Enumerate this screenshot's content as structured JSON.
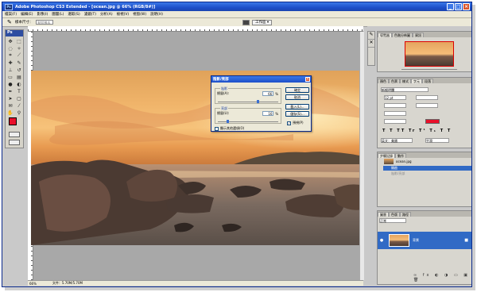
{
  "window": {
    "title": "Adobe Photoshop CS3 Extended - [ocean.jpg @ 66% (RGB/8#)]",
    "app_badge": "Ps"
  },
  "menu": [
    "檔案(F)",
    "編輯(E)",
    "影像(I)",
    "圖層(L)",
    "選取(S)",
    "濾鏡(T)",
    "分析(A)",
    "檢視(V)",
    "視窗(W)",
    "說明(H)"
  ],
  "options": {
    "label": "樣本尺寸：",
    "value": "點狀樣本",
    "workspace": "工作區 ▾"
  },
  "toolbox": {
    "title": "Ps"
  },
  "status": {
    "zoom": "66%",
    "doc": "文件：5.70M/5.70M"
  },
  "dialog": {
    "title": "陰影/亮部",
    "shadow_group": "陰影",
    "shadow_label": "總量(A):",
    "shadow_value": "66",
    "highlight_group": "亮部",
    "highlight_label": "總量(U):",
    "highlight_value": "16",
    "percent": "%",
    "show_more": "顯示其他選項(O)",
    "ok": "確定",
    "cancel": "取消",
    "load": "載入(L)...",
    "save": "儲存(S)...",
    "preview": "預視(P)",
    "shadow_level": 0.66,
    "highlight_level": 0.16
  },
  "navigator": {
    "tabs": [
      "導覽器",
      "色階分佈圖",
      "資訊"
    ]
  },
  "color_panel": {
    "tabs": [
      "顏色",
      "色票",
      "樣式"
    ],
    "tabs2": [
      "字元",
      "段落"
    ],
    "font": "新細明體",
    "size": "12 pt",
    "lang": "英文：美國",
    "aa": "平滑"
  },
  "history_panel": {
    "tabs": [
      "步驟記錄",
      "動作"
    ],
    "items": [
      "ocean.jpg",
      "開啟",
      "陰影/亮部"
    ]
  },
  "layers_panel": {
    "tabs": [
      "圖層",
      "色版",
      "路徑"
    ],
    "blend": "正常",
    "layer_name": "背景"
  },
  "colors": {
    "foreground": "#e8102a",
    "background": "#ffffff",
    "selection": "#316ac5"
  }
}
